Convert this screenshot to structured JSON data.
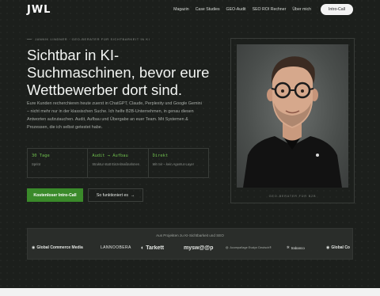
{
  "nav": {
    "logo": "JWL",
    "links": [
      "Magazin",
      "Case Studies",
      "GEO-Audit",
      "SEO ROI Rechner",
      "Über mich"
    ],
    "cta": "Intro-Call"
  },
  "hero": {
    "kicker": "JANNIK LINDNER · GEO-BERATER FÜR SICHTBARKEIT IN KI",
    "headline": [
      "Sichtbar in KI-",
      "Suchmaschinen, bevor eure",
      "Wettbewerber dort sind."
    ],
    "intro": "Eure Kunden recherchieren heute zuerst in ChatGPT, Claude, Perplexity und Google Gemini – nicht mehr nur in der klassischen Suche. Ich helfe B2B-Unternehmen, in genau diesen Antworten aufzutauchen. Audit, Aufbau und Übergabe an euer Team. Mit Systemen & Prozessen, die ich selbst getestet habe.",
    "stats": [
      {
        "title": "30 Tage",
        "sub": "Sprint"
      },
      {
        "title": "Audit → Aufbau",
        "sub": "Struktur statt Einzelmaßnahmen"
      },
      {
        "title": "Direkt",
        "sub": "Mit mir – kein Agentur-Layer"
      }
    ],
    "primary_cta": "Kostenloser Intro-Call",
    "secondary_cta": "So funktioniert es",
    "secondary_arrow": "→"
  },
  "portrait": {
    "caption": "GEO-BERATER FÜR B2B"
  },
  "clients": {
    "title": "Aus Projekten zu KI-Sichtbarkeit und SEO",
    "logos": [
      "Global Commerce Media",
      "LANNOOBERA",
      "Tarkett",
      "mysw@@p",
      "Acompañage Evalyn Deutsch®",
      "trabanco",
      "Global Co"
    ]
  },
  "colors": {
    "accent": "#3a8a2a",
    "accent_text": "#6fbf4e",
    "background": "#1c1f1c"
  }
}
